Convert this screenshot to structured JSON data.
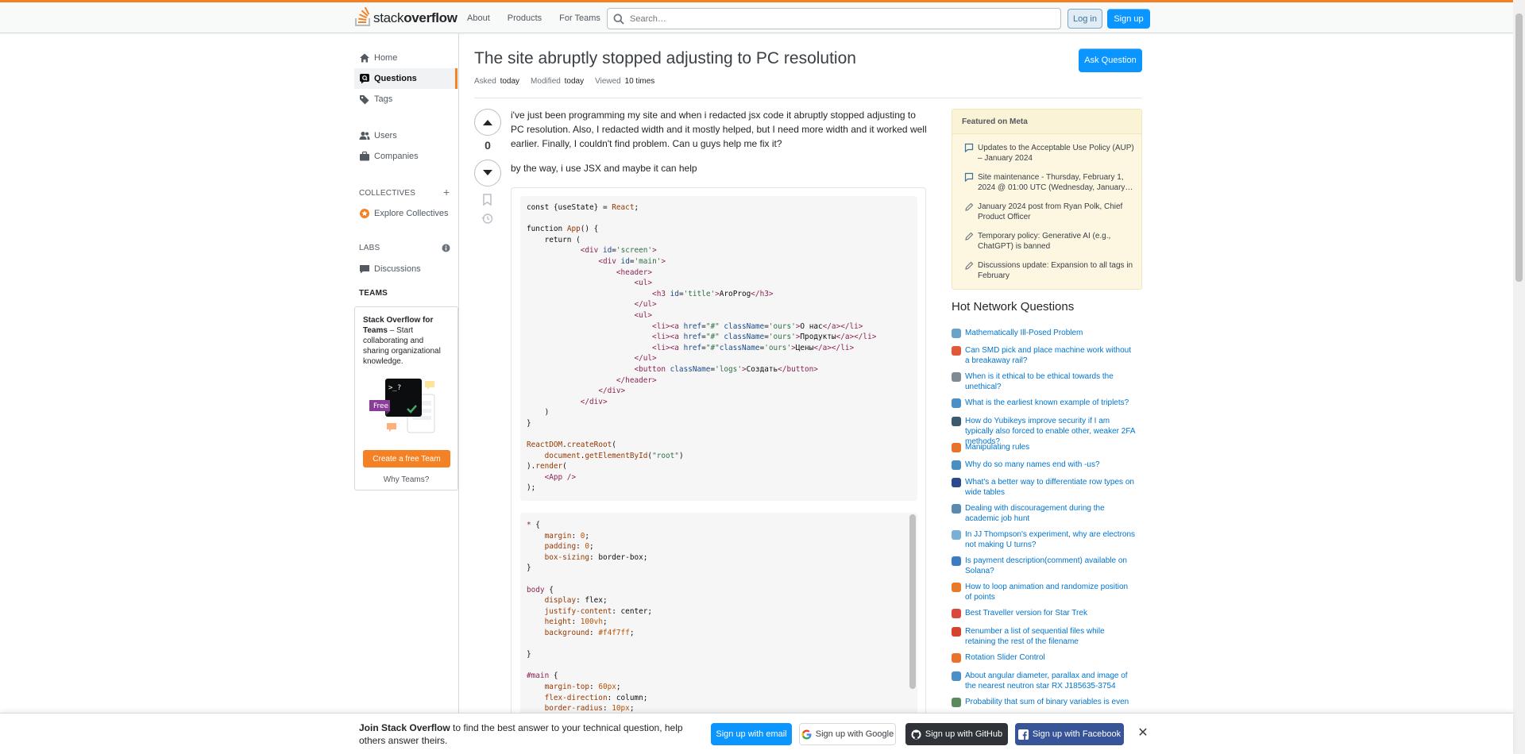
{
  "header": {
    "logo_text_light": "stack",
    "logo_text_bold": "overflow",
    "nav": [
      "About",
      "Products",
      "For Teams"
    ],
    "search_placeholder": "Search…",
    "login_label": "Log in",
    "signup_label": "Sign up",
    "accent_color": "#f48225"
  },
  "sidebar": {
    "items": [
      {
        "label": "Home",
        "icon": "home-icon"
      },
      {
        "label": "Questions",
        "icon": "questions-icon",
        "active": true
      },
      {
        "label": "Tags",
        "icon": "tag-icon"
      },
      {
        "label": "Users",
        "icon": "users-icon"
      },
      {
        "label": "Companies",
        "icon": "briefcase-icon"
      }
    ],
    "collectives_heading": "COLLECTIVES",
    "explore_collectives": "Explore Collectives",
    "labs_heading": "LABS",
    "discussions": "Discussions",
    "teams_heading": "TEAMS",
    "teams_promo_bold": "Stack Overflow for Teams",
    "teams_promo_text": " – Start collaborating and sharing organizational knowledge.",
    "teams_badge": "Free",
    "teams_prompt": ">_?",
    "create_team_label": "Create a free Team",
    "why_teams_label": "Why Teams?"
  },
  "question": {
    "title": "The site abruptly stopped adjusting to PC resolution",
    "asked_label": "Asked",
    "asked_value": "today",
    "modified_label": "Modified",
    "modified_value": "today",
    "viewed_label": "Viewed",
    "viewed_value": "10 times",
    "ask_button": "Ask Question",
    "votes": "0",
    "body_p1": "i've just been programming my site and when i redacted jsx code it abruptly stopped adjusting to PC resolution. Also, I redacted width and it mostly helped, but I need more width and it worked well earlier. Finally, I couldn't find problem. Can u guys help me fix it?",
    "body_p2": "by the way, i use JSX and maybe it can help"
  },
  "meta": {
    "heading": "Featured on Meta",
    "items": [
      "Updates to the Acceptable Use Policy (AUP) – January 2024",
      "Site maintenance - Thursday, February 1, 2024 @ 01:00 UTC (Wednesday, January…",
      "January 2024 post from Ryan Polk, Chief Product Officer",
      "Temporary policy: Generative AI (e.g., ChatGPT) is banned",
      "Discussions update: Expansion to all tags in February"
    ]
  },
  "hnq": {
    "heading": "Hot Network Questions",
    "items": [
      {
        "title": "Mathematically Ill-Posed Problem",
        "color": "#6aa3c9"
      },
      {
        "title": "Can SMD pick and place machine work without a breakaway rail?",
        "color": "#e05a3a"
      },
      {
        "title": "When is it ethical to be ethical towards the unethical?",
        "color": "#7e8a94"
      },
      {
        "title": "What is the earliest known example of triplets?",
        "color": "#4a90c8"
      },
      {
        "title": "How do Yubikeys improve security if I am typically also forced to enable other, weaker 2FA methods?",
        "color": "#3c5a6e"
      },
      {
        "title": "Manipulating rules",
        "color": "#e8742c"
      },
      {
        "title": "Why do so many names end with -us?",
        "color": "#4a8fc2"
      },
      {
        "title": "What's a better way to differentiate row types on wide tables",
        "color": "#2b4a8c"
      },
      {
        "title": "Dealing with discouragement during the academic job hunt",
        "color": "#5a8ab0"
      },
      {
        "title": "In JJ Thompson's experiment, why are electrons not making U turns?",
        "color": "#79b0d4"
      },
      {
        "title": "Is payment description(comment) available on Solana?",
        "color": "#3d7cc2"
      },
      {
        "title": "How to loop animation and randomize position of points",
        "color": "#e87b2b"
      },
      {
        "title": "Best Traveller version for Star Trek",
        "color": "#d9483b"
      },
      {
        "title": "Renumber a list of sequential files while retaining the rest of the filename",
        "color": "#d4432e"
      },
      {
        "title": "Rotation Slider Control",
        "color": "#e8742c"
      },
      {
        "title": "About angular diameter, parallax and image of the nearest neutron star RX J185635-3754",
        "color": "#4a90c8"
      },
      {
        "title": "Probability that sum of binary variables is even",
        "color": "#5a8a5e"
      }
    ]
  },
  "banner": {
    "bold": "Join Stack Overflow",
    "text": " to find the best answer to your technical question, help others answer theirs.",
    "email_label": "Sign up with email",
    "google_label": "Sign up with Google",
    "github_label": "Sign up with GitHub",
    "facebook_label": "Sign up with Facebook"
  }
}
